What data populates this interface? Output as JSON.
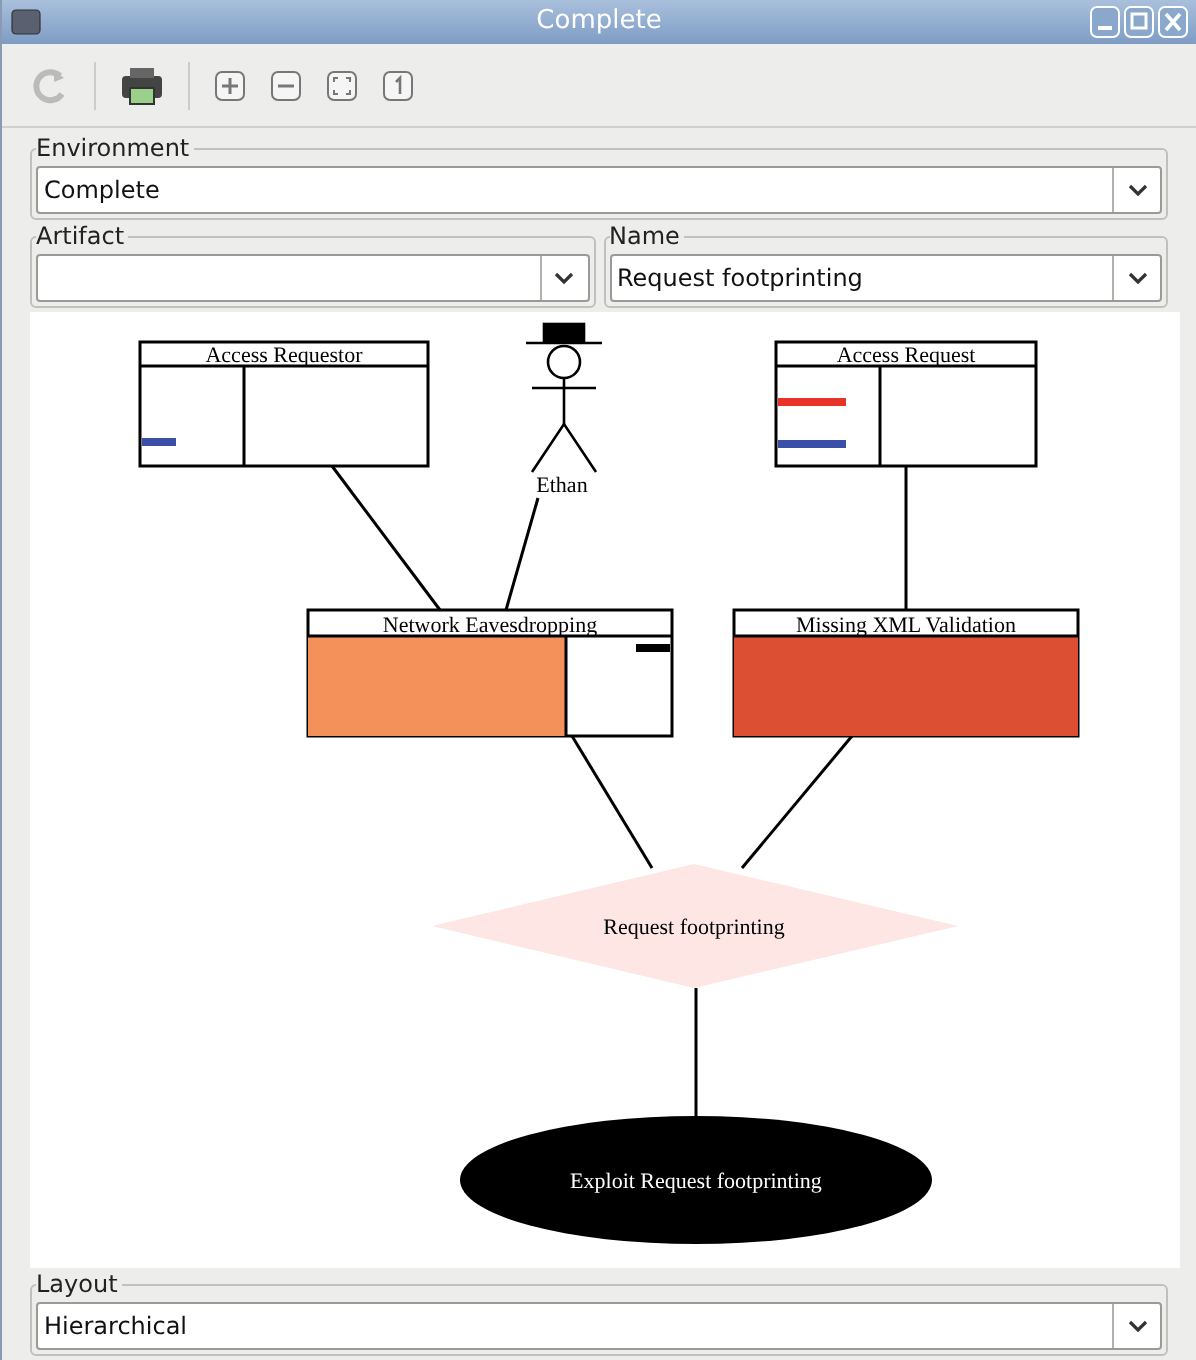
{
  "window": {
    "title": "Complete"
  },
  "environment": {
    "label": "Environment",
    "value": "Complete"
  },
  "artifact": {
    "label": "Artifact"
  },
  "name": {
    "label": "Name",
    "value": "Request footprinting"
  },
  "diagram": {
    "nodes": [
      {
        "kind": "asset",
        "label": "Access Requestor"
      },
      {
        "kind": "persona",
        "label": "Ethan"
      },
      {
        "kind": "asset",
        "label": "Access Request"
      },
      {
        "kind": "threat",
        "label": "Network Eavesdropping",
        "color": "#f4905a"
      },
      {
        "kind": "vulnerability",
        "label": "Missing XML Validation",
        "color": "#dc4f32"
      },
      {
        "kind": "diamond",
        "label": "Request footprinting"
      },
      {
        "kind": "ellipse",
        "label": "Exploit Request footprinting"
      }
    ]
  },
  "layout": {
    "label": "Layout",
    "value": "Hierarchical"
  }
}
